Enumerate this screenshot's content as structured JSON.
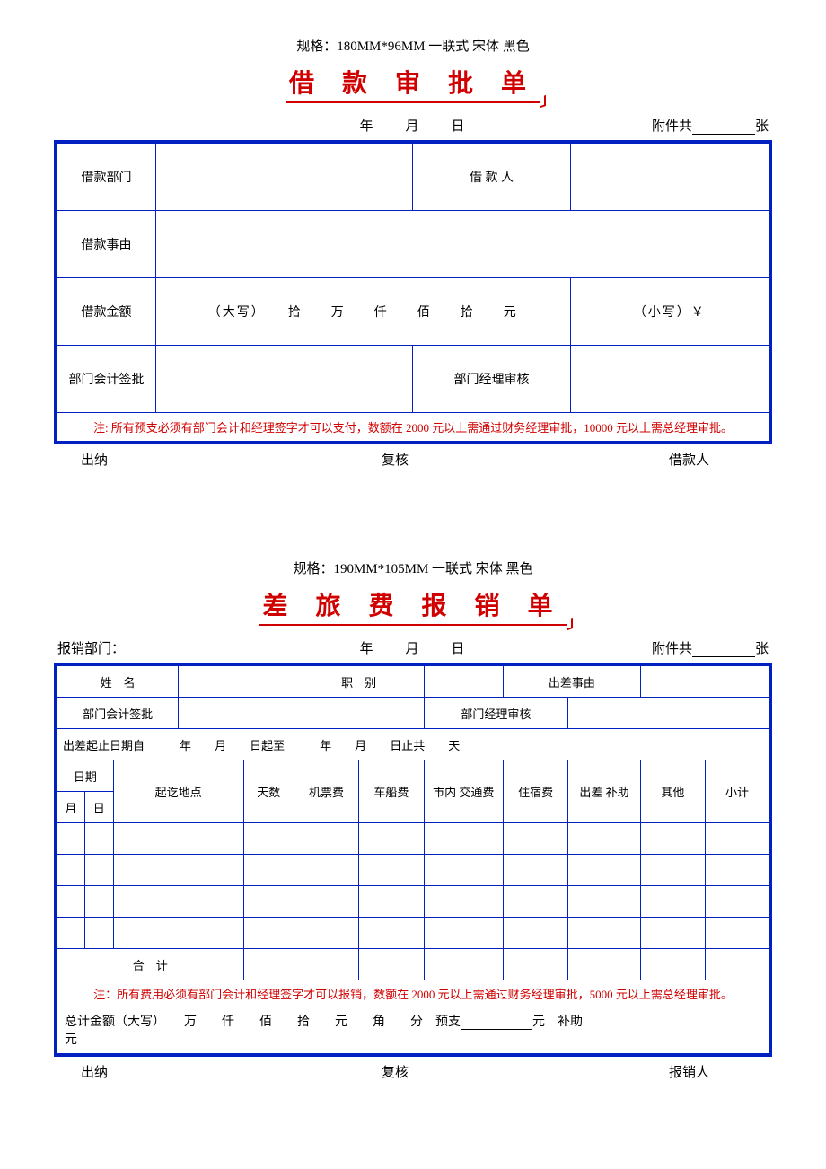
{
  "form1": {
    "spec": "规格：180MM*96MM  一联式  宋体  黑色",
    "title": "借 款 审 批 单",
    "date_row": "年　　月　　日",
    "attachment_prefix": "附件共",
    "attachment_suffix": "张",
    "labels": {
      "dept": "借款部门",
      "borrower": "借 款 人",
      "reason": "借款事由",
      "amount": "借款金额",
      "amount_big_prefix": "（大写）",
      "amount_big_units": "拾　　万　　仟　　佰　　拾　　元",
      "amount_small_prefix": "（小写）￥",
      "dept_acct_approve": "部门会计签批",
      "dept_mgr_approve": "部门经理审核"
    },
    "note": "注:  所有预支必须有部门会计和经理签字才可以支付，数额在 2000 元以上需通过财务经理审批，10000 元以上需总经理审批。",
    "footer": {
      "left": "出纳",
      "center": "复核",
      "right": "借款人"
    }
  },
  "form2": {
    "spec": "规格：190MM*105MM  一联式  宋体  黑色",
    "title": "差 旅 费 报 销 单",
    "dept_label": "报销部门：",
    "date_row": "年　　月　　日",
    "attachment_prefix": "附件共",
    "attachment_suffix": "张",
    "row1": {
      "name": "姓　名",
      "rank": "职　别",
      "reason": "出差事由"
    },
    "row2": {
      "acct": "部门会计签批",
      "mgr": "部门经理审核"
    },
    "dates_line": {
      "prefix": "出差起止日期自",
      "y1": "年",
      "m1": "月",
      "d1_to": "日起至",
      "y2": "年",
      "m2": "月",
      "d2_end": "日止共",
      "days": "天"
    },
    "cols": {
      "date": "日期",
      "month": "月",
      "day": "日",
      "place": "起讫地点",
      "days": "天数",
      "airfare": "机票费",
      "trainfare": "车船费",
      "citytrans": "市内 交通费",
      "lodging": "住宿费",
      "allowance": "出差 补助",
      "other": "其他",
      "subtotal": "小计"
    },
    "total_label": "合　计",
    "note": "注：所有费用必须有部门会计和经理签字才可以报销，数额在 2000 元以上需通过财务经理审批，5000 元以上需总经理审批。",
    "total_amount": {
      "prefix": "总计金额（大写）",
      "units": "万　　仟　　佰　　拾　　元　　角　　分",
      "advance_label": "预支",
      "advance_unit": "元",
      "allowance_label": "补助",
      "suffix_unit": "元"
    },
    "footer": {
      "left": "出纳",
      "center": "复核",
      "right": "报销人"
    }
  }
}
